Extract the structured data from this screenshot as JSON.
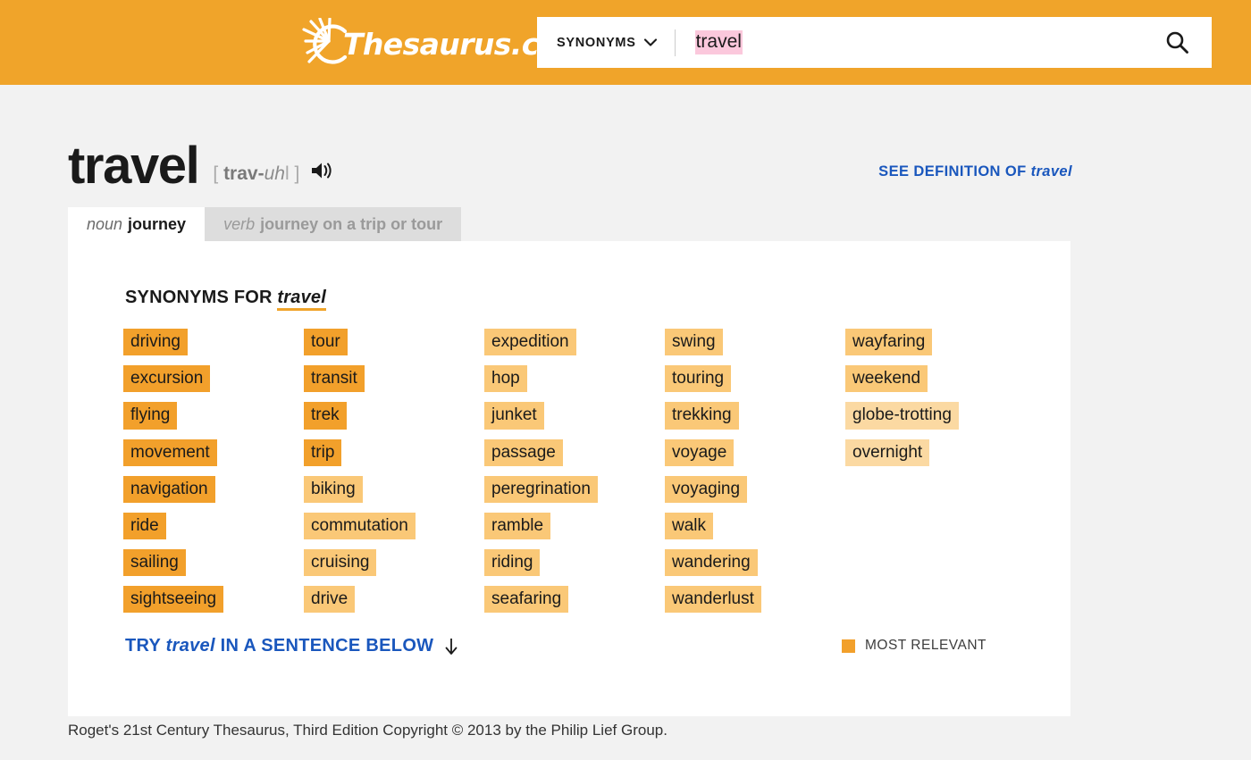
{
  "header": {
    "logo_text": "Thesaurus.com",
    "logo_icon": "sun-burst-icon",
    "search": {
      "type_label": "SYNONYMS",
      "chevron_icon": "chevron-down-icon",
      "value": "travel",
      "placeholder": "",
      "button_icon": "search-icon"
    },
    "background_color": "#f0a42a"
  },
  "entry": {
    "headword": "travel",
    "pron_open": "[",
    "pron_stress": "trav-",
    "pron_schwa": "uh",
    "pron_tail": "l",
    "pron_close": "]",
    "speaker_icon": "speaker-audio-icon",
    "see_definition_prefix": "SEE DEFINITION OF ",
    "see_definition_word": "travel"
  },
  "tabs": [
    {
      "pos": "noun",
      "term": "journey",
      "active": true
    },
    {
      "pos": "verb",
      "term": "journey on a trip or tour",
      "active": false
    }
  ],
  "synonyms_panel": {
    "title_prefix": "SYNONYMS FOR ",
    "title_word": "travel",
    "columns": [
      {
        "items": [
          {
            "word": "driving",
            "relevance": 3
          },
          {
            "word": "excursion",
            "relevance": 3
          },
          {
            "word": "flying",
            "relevance": 3
          },
          {
            "word": "movement",
            "relevance": 3
          },
          {
            "word": "navigation",
            "relevance": 3
          },
          {
            "word": "ride",
            "relevance": 3
          },
          {
            "word": "sailing",
            "relevance": 3
          },
          {
            "word": "sightseeing",
            "relevance": 3
          }
        ]
      },
      {
        "items": [
          {
            "word": "tour",
            "relevance": 3
          },
          {
            "word": "transit",
            "relevance": 3
          },
          {
            "word": "trek",
            "relevance": 3
          },
          {
            "word": "trip",
            "relevance": 3
          },
          {
            "word": "biking",
            "relevance": 2
          },
          {
            "word": "commutation",
            "relevance": 2
          },
          {
            "word": "cruising",
            "relevance": 2
          },
          {
            "word": "drive",
            "relevance": 2
          }
        ]
      },
      {
        "items": [
          {
            "word": "expedition",
            "relevance": 2
          },
          {
            "word": "hop",
            "relevance": 2
          },
          {
            "word": "junket",
            "relevance": 2
          },
          {
            "word": "passage",
            "relevance": 2
          },
          {
            "word": "peregrination",
            "relevance": 2
          },
          {
            "word": "ramble",
            "relevance": 2
          },
          {
            "word": "riding",
            "relevance": 2
          },
          {
            "word": "seafaring",
            "relevance": 2
          }
        ]
      },
      {
        "items": [
          {
            "word": "swing",
            "relevance": 2
          },
          {
            "word": "touring",
            "relevance": 2
          },
          {
            "word": "trekking",
            "relevance": 2
          },
          {
            "word": "voyage",
            "relevance": 2
          },
          {
            "word": "voyaging",
            "relevance": 2
          },
          {
            "word": "walk",
            "relevance": 2
          },
          {
            "word": "wandering",
            "relevance": 2
          },
          {
            "word": "wanderlust",
            "relevance": 2
          }
        ]
      },
      {
        "items": [
          {
            "word": "wayfaring",
            "relevance": 2
          },
          {
            "word": "weekend",
            "relevance": 2
          },
          {
            "word": "globe-trotting",
            "relevance": 1
          },
          {
            "word": "overnight",
            "relevance": 1
          }
        ]
      }
    ],
    "try_link_prefix": "TRY ",
    "try_link_word": "travel",
    "try_link_suffix": " IN A SENTENCE BELOW",
    "try_link_icon": "arrow-down-icon",
    "legend_label": "MOST RELEVANT",
    "legend_color": "#f2a02b"
  },
  "footer": {
    "copyright": "Roget's 21st Century Thesaurus, Third Edition Copyright © 2013 by the Philip Lief Group."
  }
}
